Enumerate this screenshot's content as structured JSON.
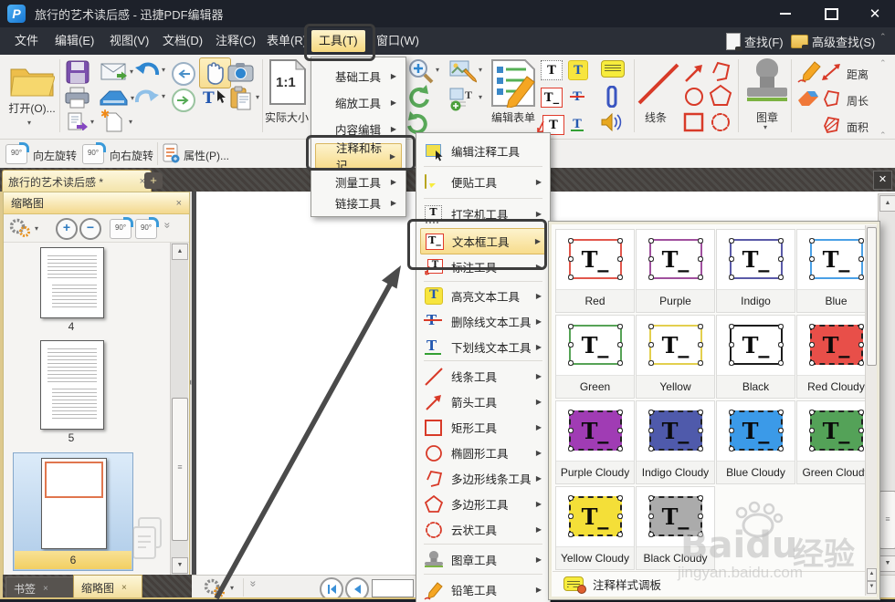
{
  "titlebar": {
    "title": "旅行的艺术读后感 - 迅捷PDF编辑器"
  },
  "menubar": {
    "items": [
      {
        "label": "文件"
      },
      {
        "label": "编辑(E)"
      },
      {
        "label": "视图(V)"
      },
      {
        "label": "文档(D)"
      },
      {
        "label": "注释(C)"
      },
      {
        "label": "表单(R)"
      },
      {
        "label": "工具(T)",
        "highlighted": true
      },
      {
        "label": "窗口(W)"
      }
    ],
    "find": "查找(F)",
    "advanced_find": "高级查找(S)"
  },
  "toolbar": {
    "open_label": "打开(O)...",
    "one_to_one": "1:1",
    "actual_size_label": "实际大小",
    "edit_form_label": "编辑表单",
    "line_label": "线条",
    "stamp_label": "图章",
    "distance_label": "距离",
    "perimeter_label": "周长",
    "area_label": "面积"
  },
  "toolbar2": {
    "rotate_left_label": "向左旋转",
    "rotate_right_label": "向右旋转",
    "properties_label": "属性(P)..."
  },
  "doc_tabbar": {
    "tab_title": "旅行的艺术读后感 *"
  },
  "thumb_panel": {
    "title": "缩略图",
    "page_numbers": [
      "4",
      "5",
      "6"
    ],
    "selected_page": "6"
  },
  "bottom_tabs": {
    "bookmarks": "书签",
    "thumbnails": "缩略图"
  },
  "tools_menu": {
    "items": [
      {
        "label": "基础工具"
      },
      {
        "label": "缩放工具"
      },
      {
        "label": "内容编辑"
      },
      {
        "label": "注释和标记",
        "highlighted": true
      },
      {
        "label": "测量工具"
      },
      {
        "label": "链接工具"
      }
    ]
  },
  "annotation_menu": {
    "items": [
      {
        "label": "编辑注释工具"
      },
      {
        "label": "便贴工具"
      },
      {
        "label": "打字机工具"
      },
      {
        "label": "文本框工具",
        "highlighted": true
      },
      {
        "label": "标注工具"
      },
      {
        "label": "高亮文本工具"
      },
      {
        "label": "删除线文本工具"
      },
      {
        "label": "下划线文本工具"
      },
      {
        "label": "线条工具"
      },
      {
        "label": "箭头工具"
      },
      {
        "label": "矩形工具"
      },
      {
        "label": "椭圆形工具"
      },
      {
        "label": "多边形线条工具"
      },
      {
        "label": "多边形工具"
      },
      {
        "label": "云状工具"
      },
      {
        "label": "图章工具"
      },
      {
        "label": "铅笔工具"
      }
    ]
  },
  "style_panel": {
    "glyph": "T_",
    "styles": [
      {
        "name": "Red",
        "color": "#e2574c",
        "cloudy": false
      },
      {
        "name": "Purple",
        "color": "#a0509e",
        "cloudy": false
      },
      {
        "name": "Indigo",
        "color": "#5a5aa8",
        "cloudy": false
      },
      {
        "name": "Blue",
        "color": "#4aa0e6",
        "cloudy": false
      },
      {
        "name": "Green",
        "color": "#56a356",
        "cloudy": false
      },
      {
        "name": "Yellow",
        "color": "#e3cf4e",
        "cloudy": false
      },
      {
        "name": "Black",
        "color": "#1c1c1c",
        "cloudy": false
      },
      {
        "name": "Red Cloudy",
        "color": "#e84f49",
        "cloudy": true
      },
      {
        "name": "Purple Cloudy",
        "color": "#a03cb4",
        "cloudy": true
      },
      {
        "name": "Indigo Cloudy",
        "color": "#4f5aab",
        "cloudy": true
      },
      {
        "name": "Blue Cloudy",
        "color": "#3b9ae8",
        "cloudy": true
      },
      {
        "name": "Green Cloudy",
        "color": "#54a258",
        "cloudy": true
      },
      {
        "name": "Yellow Cloudy",
        "color": "#f4df38",
        "cloudy": true
      },
      {
        "name": "Black Cloudy",
        "color": "#ababab",
        "cloudy": true
      }
    ],
    "footer_label": "注释样式调板"
  },
  "watermark": {
    "brand": "Baidu",
    "brand_cn": "经验",
    "url": "jingyan.baidu.com"
  },
  "glyphs": {
    "logo": "P",
    "caret": "▾",
    "menu_arrow": "▶",
    "chev_up": "⌃",
    "chev_double": "»",
    "up": "▲",
    "down": "▼",
    "left_tri": "◀",
    "grip": "≡",
    "star": "✱",
    "close": "✕",
    "close_small": "×",
    "plus": "+",
    "minus": "−",
    "T": "T",
    "T_underscore": "T_",
    "rotate_badge": "90°"
  }
}
